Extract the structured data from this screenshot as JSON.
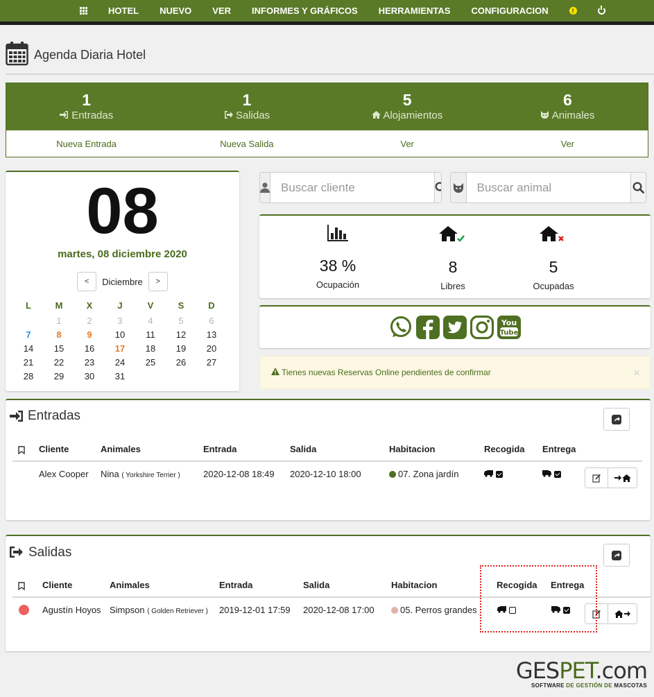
{
  "nav": {
    "items": [
      "HOTEL",
      "NUEVO",
      "VER",
      "INFORMES Y GRÁFICOS",
      "HERRAMIENTAS",
      "CONFIGURACION"
    ]
  },
  "page": {
    "title": "Agenda Diaria Hotel"
  },
  "summary": {
    "entradas": {
      "count": "1",
      "label": "Entradas",
      "link": "Nueva Entrada"
    },
    "salidas": {
      "count": "1",
      "label": "Salidas",
      "link": "Nueva Salida"
    },
    "alojamientos": {
      "count": "5",
      "label": "Alojamientos",
      "link": "Ver"
    },
    "animales": {
      "count": "6",
      "label": "Animales",
      "link": "Ver"
    }
  },
  "calendar": {
    "day": "08",
    "long_date": "martes, 08 diciembre 2020",
    "prev": "<",
    "next": ">",
    "month": "Diciembre",
    "weekdays": [
      "L",
      "M",
      "X",
      "J",
      "V",
      "S",
      "D"
    ],
    "weeks": [
      [
        "1",
        "2",
        "3",
        "4",
        "5",
        "6"
      ],
      [
        "7",
        "8",
        "9",
        "10",
        "11",
        "12",
        "13"
      ],
      [
        "14",
        "15",
        "16",
        "17",
        "18",
        "19",
        "20"
      ],
      [
        "21",
        "22",
        "23",
        "24",
        "25",
        "26",
        "27"
      ],
      [
        "28",
        "29",
        "30",
        "31"
      ]
    ]
  },
  "search": {
    "cliente_placeholder": "Buscar cliente",
    "animal_placeholder": "Buscar animal"
  },
  "stats": {
    "ocupacion": {
      "value": "38 %",
      "label": "Ocupación"
    },
    "libres": {
      "value": "8",
      "label": "Libres"
    },
    "ocupadas": {
      "value": "5",
      "label": "Ocupadas"
    }
  },
  "alert": {
    "text": "Tienes nuevas Reservas Online pendientes de confirmar",
    "close": "×"
  },
  "entradas": {
    "title": "Entradas",
    "headers": [
      "Cliente",
      "Animales",
      "Entrada",
      "Salida",
      "Habitacion",
      "Recogida",
      "Entrega"
    ],
    "row": {
      "cliente": "Alex Cooper",
      "animal": "Nina",
      "breed": "( Yorkshire Terrier )",
      "entrada": "2020-12-08 18:49",
      "salida": "2020-12-10 18:00",
      "habitacion": "07. Zona jardín",
      "hab_color": "#4f6f22"
    }
  },
  "salidas": {
    "title": "Salidas",
    "headers": [
      "Cliente",
      "Animales",
      "Entrada",
      "Salida",
      "Habitacion",
      "Recogida",
      "Entrega"
    ],
    "row": {
      "cliente": "Agustín Hoyos",
      "animal": "Simpson",
      "breed": "( Golden Retriever )",
      "entrada": "2019-12-01 17:59",
      "salida": "2020-12-08 17:00",
      "habitacion": "05. Perros grandes",
      "hab_color": "#e4b2aa",
      "status_color": "#f06060"
    }
  },
  "brand": {
    "name_a": "GES",
    "name_b": "PET",
    "name_c": ".com",
    "tagline_a": "SOFTWARE ",
    "tagline_b": "DE GESTIÓN DE ",
    "tagline_c": "MASCOTAS"
  },
  "colors": {
    "primary": "#5a7a28",
    "accent_text": "#4a6b1c",
    "orange": "#e07b2e",
    "blue": "#2b90d9"
  }
}
